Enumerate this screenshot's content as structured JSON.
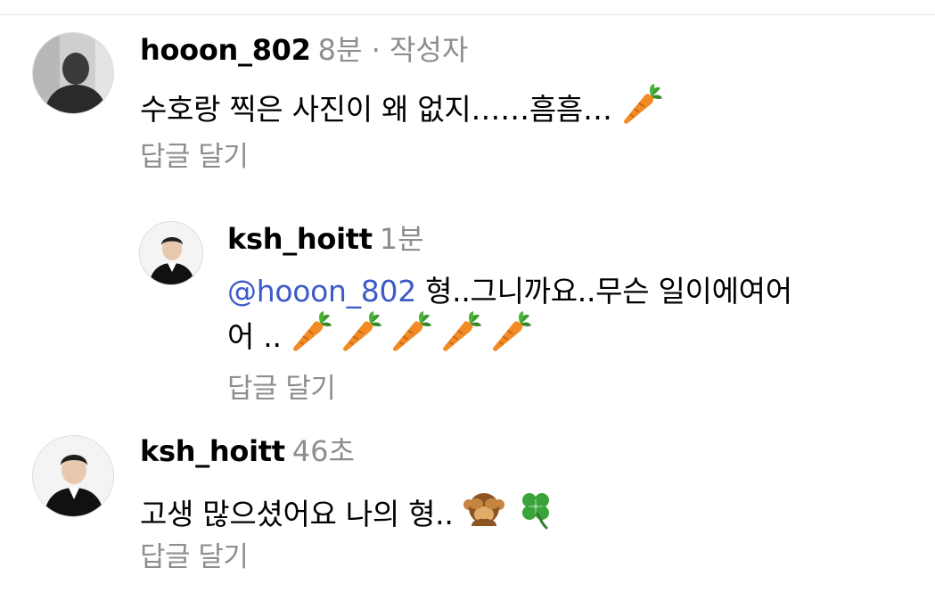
{
  "comments": [
    {
      "username": "hooon_802",
      "meta": "8분 · 작성자",
      "text": "수호랑 찍은 사진이 왜 없지……흠흠…",
      "emoji": "carrot",
      "reply_label": "답글 달기"
    },
    {
      "username": "ksh_hoitt",
      "meta": "1분",
      "mention": "@hooon_802",
      "text_line1": " 형..그니까요..무슨 일이에여어",
      "text_line2": "어 ..",
      "emoji": "carrot",
      "reply_label": "답글 달기"
    },
    {
      "username": "ksh_hoitt",
      "meta": "46초",
      "text": "고생 많으셨어요 나의 형..",
      "emoji": [
        "see-no-evil-monkey",
        "four-leaf-clover"
      ],
      "reply_label": "답글 달기"
    }
  ],
  "colors": {
    "username": "#000000",
    "meta": "#8e8e8e",
    "mention": "#3d5ac9",
    "divider": "#e6e6e6"
  }
}
